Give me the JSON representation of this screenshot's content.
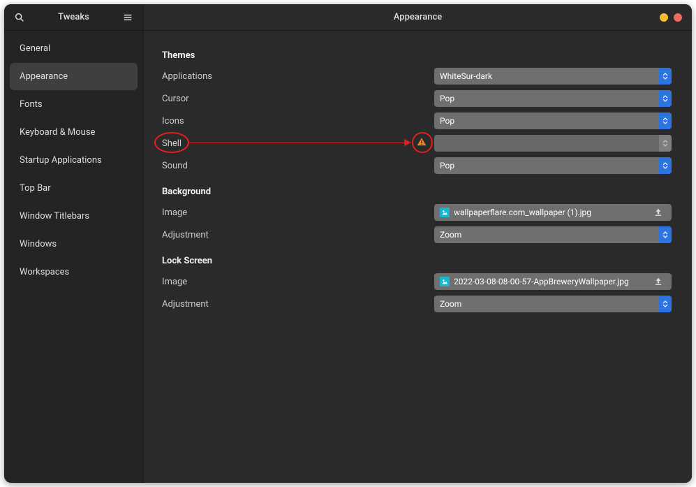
{
  "app": {
    "title": "Tweaks",
    "page_title": "Appearance"
  },
  "sidebar": {
    "items": [
      {
        "label": "General"
      },
      {
        "label": "Appearance"
      },
      {
        "label": "Fonts"
      },
      {
        "label": "Keyboard & Mouse"
      },
      {
        "label": "Startup Applications"
      },
      {
        "label": "Top Bar"
      },
      {
        "label": "Window Titlebars"
      },
      {
        "label": "Windows"
      },
      {
        "label": "Workspaces"
      }
    ],
    "active_index": 1
  },
  "themes": {
    "section_label": "Themes",
    "applications": {
      "label": "Applications",
      "value": "WhiteSur-dark"
    },
    "cursor": {
      "label": "Cursor",
      "value": "Pop"
    },
    "icons": {
      "label": "Icons",
      "value": "Pop"
    },
    "shell": {
      "label": "Shell",
      "value": "",
      "warning": true
    },
    "sound": {
      "label": "Sound",
      "value": "Pop"
    }
  },
  "background": {
    "section_label": "Background",
    "image": {
      "label": "Image",
      "filename": "wallpaperflare.com_wallpaper (1).jpg"
    },
    "adjustment": {
      "label": "Adjustment",
      "value": "Zoom"
    }
  },
  "lockscreen": {
    "section_label": "Lock Screen",
    "image": {
      "label": "Image",
      "filename": "2022-03-08-08-00-57-AppBreweryWallpaper.jpg"
    },
    "adjustment": {
      "label": "Adjustment",
      "value": "Zoom"
    }
  }
}
